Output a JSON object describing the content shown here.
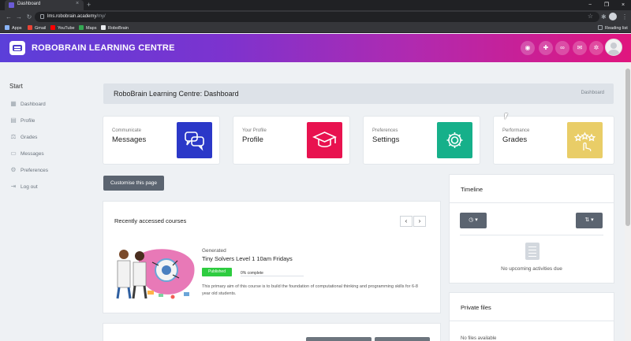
{
  "browser": {
    "tab_title": "Dashboard",
    "tab_close": "×",
    "new_tab": "+",
    "url_host": "lms.robobrain.academy",
    "url_path": "/my/",
    "bookmarks": [
      "Apps",
      "Gmail",
      "YouTube",
      "Maps",
      "RoboBrain"
    ],
    "reading_list": "Reading list",
    "window_controls": [
      "−",
      "❐",
      "×"
    ]
  },
  "header": {
    "brand": "ROBOBRAIN LEARNING CENTRE",
    "icons": [
      "eye-icon",
      "puzzle-icon",
      "link-icon",
      "mail-icon",
      "gear-icon"
    ]
  },
  "sidebar": {
    "heading": "Start",
    "items": [
      {
        "label": "Dashboard",
        "icon": "dashboard-icon"
      },
      {
        "label": "Profile",
        "icon": "profile-icon"
      },
      {
        "label": "Grades",
        "icon": "grades-icon"
      },
      {
        "label": "Messages",
        "icon": "messages-icon"
      },
      {
        "label": "Preferences",
        "icon": "preferences-icon"
      },
      {
        "label": "Log out",
        "icon": "logout-icon"
      }
    ]
  },
  "page": {
    "title": "RoboBrain Learning Centre: Dashboard",
    "breadcrumb": "Dashboard"
  },
  "cards": [
    {
      "label": "Communicate",
      "title": "Messages",
      "color": "#2b38c8",
      "icon": "chat-icon"
    },
    {
      "label": "Your Profile",
      "title": "Profile",
      "color": "#e8124f",
      "icon": "graduation-cap-icon"
    },
    {
      "label": "Preferences",
      "title": "Settings",
      "color": "#16b08a",
      "icon": "gear-icon"
    },
    {
      "label": "Performance",
      "title": "Grades",
      "color": "#e9cd67",
      "icon": "stars-icon"
    }
  ],
  "customise_label": "Customise this page",
  "courses": {
    "title": "Recently accessed courses",
    "prev": "‹",
    "next": "›",
    "item": {
      "category": "Generated",
      "name": "Tiny Solvers Level 1 10am Fridays",
      "status": "Published",
      "progress_text": "0% complete",
      "progress": 0,
      "summary": "This primary aim of this course is to build the foundation of computational thinking and programming skills for 6-8 year old students."
    }
  },
  "timeline": {
    "title": "Timeline",
    "empty": "No upcoming activities due"
  },
  "private_files": {
    "title": "Private files",
    "empty": "No files available"
  }
}
